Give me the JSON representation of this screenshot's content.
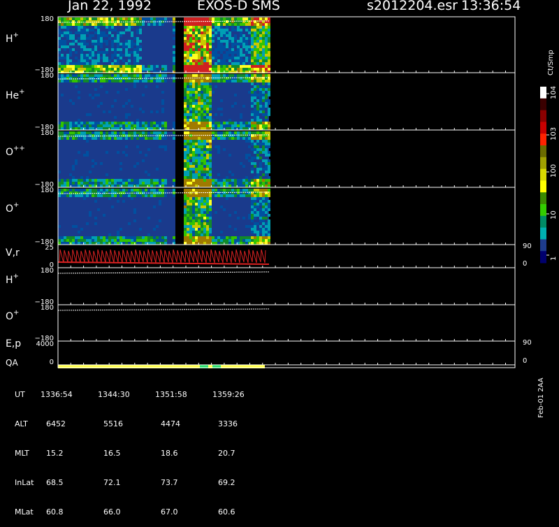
{
  "header": {
    "date": "Jan 22, 1992",
    "instrument": "EXOS-D SMS",
    "filename": "s2012204.esr",
    "time": "13:36:54"
  },
  "colorbar": {
    "unit": "Ct/Smp",
    "ticks": [
      "10^4",
      "10^3",
      "100",
      "10",
      "1"
    ],
    "colors": [
      "#ffffff",
      "#3a0000",
      "#8b0000",
      "#c80000",
      "#ff2200",
      "#6b6b00",
      "#a0a000",
      "#d8d800",
      "#ffff00",
      "#3a8a00",
      "#33cc00",
      "#008c66",
      "#00b0b0",
      "#1e3c8c",
      "#00006e"
    ]
  },
  "footer": {
    "rows": [
      {
        "label": "UT",
        "values": [
          "1336:54",
          "1344:30",
          "1351:58",
          "1359:26"
        ]
      },
      {
        "label": "ALT",
        "values": [
          "6452",
          "5516",
          "4474",
          "3336"
        ]
      },
      {
        "label": "MLT",
        "values": [
          "15.2",
          "16.5",
          "18.6",
          "20.7"
        ]
      },
      {
        "label": "InLat",
        "values": [
          "68.5",
          "72.1",
          "73.7",
          "69.2"
        ]
      },
      {
        "label": "MLat",
        "values": [
          "60.8",
          "66.0",
          "67.0",
          "60.6"
        ]
      }
    ],
    "version": "Feb-01 2AA"
  },
  "chart_data": [
    {
      "type": "heatmap",
      "panel": "H+",
      "label": "H",
      "sup": "+",
      "ylim": [
        -180,
        180
      ],
      "ytick_labels": [
        "180",
        "−180"
      ],
      "color_scale": "log",
      "has_data": true
    },
    {
      "type": "heatmap",
      "panel": "He+",
      "label": "He",
      "sup": "+",
      "ylim": [
        -180,
        180
      ],
      "ytick_labels": [
        "180",
        "−180"
      ],
      "color_scale": "log",
      "has_data": true
    },
    {
      "type": "heatmap",
      "panel": "O++",
      "label": "O",
      "sup": "++",
      "ylim": [
        -180,
        180
      ],
      "ytick_labels": [
        "180",
        "−180"
      ],
      "color_scale": "log",
      "has_data": true
    },
    {
      "type": "heatmap",
      "panel": "O+",
      "label": "O",
      "sup": "+",
      "ylim": [
        -180,
        180
      ],
      "ytick_labels": [
        "180",
        "−180"
      ],
      "color_scale": "log",
      "has_data": true
    },
    {
      "type": "line",
      "panel": "V,r",
      "label": "V,r",
      "ylim_left": [
        0,
        25
      ],
      "ytick_left": [
        "25",
        "0"
      ],
      "ytick_right": [
        "90",
        "0"
      ],
      "series_color": "#dd2222"
    },
    {
      "type": "heatmap",
      "panel": "H+ (2)",
      "label": "H",
      "sup": "+",
      "ylim": [
        -180,
        180
      ],
      "ytick_labels": [
        "180",
        "−180"
      ],
      "has_data": false
    },
    {
      "type": "heatmap",
      "panel": "O+ (2)",
      "label": "O",
      "sup": "+",
      "ylim": [
        -180,
        180
      ],
      "ytick_labels": [
        "180",
        "−180"
      ],
      "has_data": false
    },
    {
      "type": "line",
      "panel": "E,p",
      "label": "E,p",
      "ytick_left": [
        "4000",
        "0"
      ],
      "ytick_right": [
        "90",
        "0"
      ]
    },
    {
      "type": "bar",
      "panel": "QA",
      "label": "QA",
      "color": "#ffff44",
      "marks_color": "#22dd66"
    }
  ]
}
